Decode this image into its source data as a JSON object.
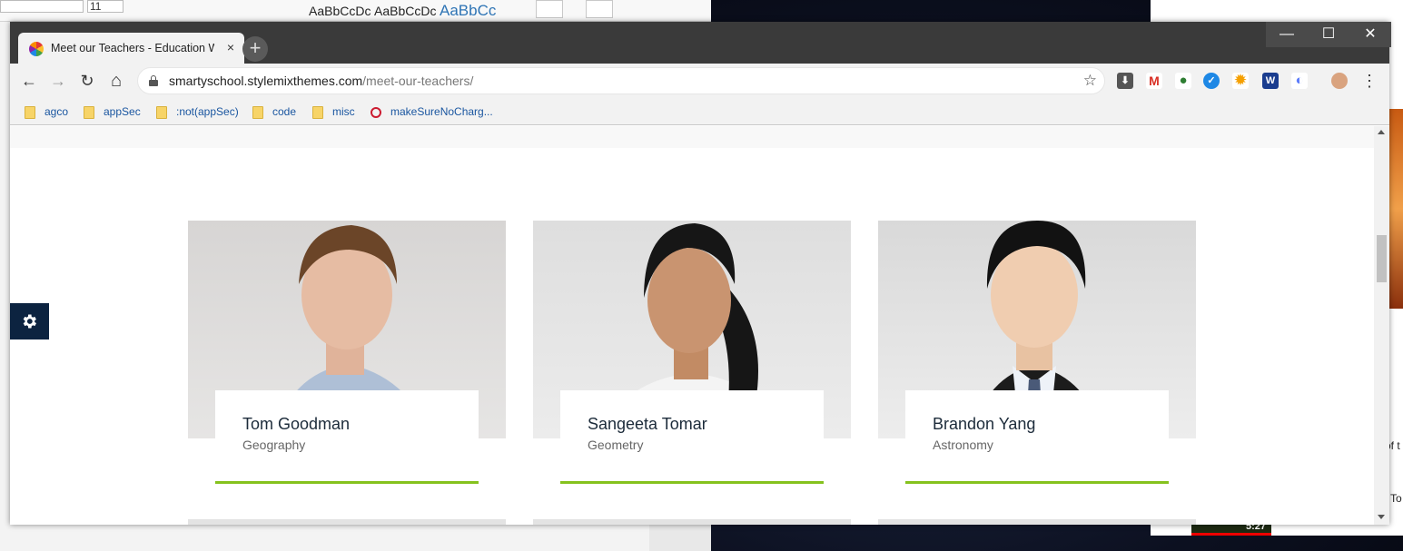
{
  "background": {
    "word_styles": [
      "AaBbCcDc",
      "AaBbCcDc",
      "AaBbCc"
    ],
    "word_font_size": "11",
    "youtube_time": "5:27",
    "right_fragments": [
      "of t",
      "To"
    ]
  },
  "tab": {
    "title": "Meet our Teachers - Education W",
    "close": "×"
  },
  "new_tab_symbol": "+",
  "window_controls": {
    "minimize": "—",
    "maximize": "☐",
    "close": "✕"
  },
  "nav": {
    "back": "←",
    "forward": "→",
    "reload": "↻",
    "home": "⌂"
  },
  "address": {
    "host": "smartyschool.stylemixthemes.com",
    "path": "/meet-our-teachers/",
    "star": "☆"
  },
  "extensions": [
    {
      "icon": "download-icon",
      "label": "⬇",
      "color": "#444444"
    },
    {
      "icon": "gmail-icon",
      "label": "M",
      "color": "#d93025"
    },
    {
      "icon": "globe-icon",
      "label": "●",
      "color": "#2e7d32"
    },
    {
      "icon": "check-icon",
      "label": "✓",
      "color": "#1e88e5"
    },
    {
      "icon": "sun-icon",
      "label": "✹",
      "color": "#f59f00"
    },
    {
      "icon": "w-extension-icon",
      "label": "W",
      "color": "#1a3d8f"
    },
    {
      "icon": "ring-icon",
      "label": "◐",
      "color": "#5c7cfa"
    }
  ],
  "menu_dots": "⋮",
  "bookmarks": [
    {
      "label": "agco",
      "type": "folder"
    },
    {
      "label": "appSec",
      "type": "folder"
    },
    {
      "label": ":not(appSec)",
      "type": "folder"
    },
    {
      "label": "code",
      "type": "folder"
    },
    {
      "label": "misc",
      "type": "folder"
    },
    {
      "label": "makeSureNoCharg...",
      "type": "opera"
    }
  ],
  "teachers": [
    {
      "name": "Tom Goodman",
      "subject": "Geography"
    },
    {
      "name": "Sangeeta Tomar",
      "subject": "Geometry"
    },
    {
      "name": "Brandon Yang",
      "subject": "Astronomy"
    }
  ],
  "colors": {
    "accent": "#85c21e",
    "navy": "#0c2340",
    "titlebar": "#3a3a3a"
  }
}
